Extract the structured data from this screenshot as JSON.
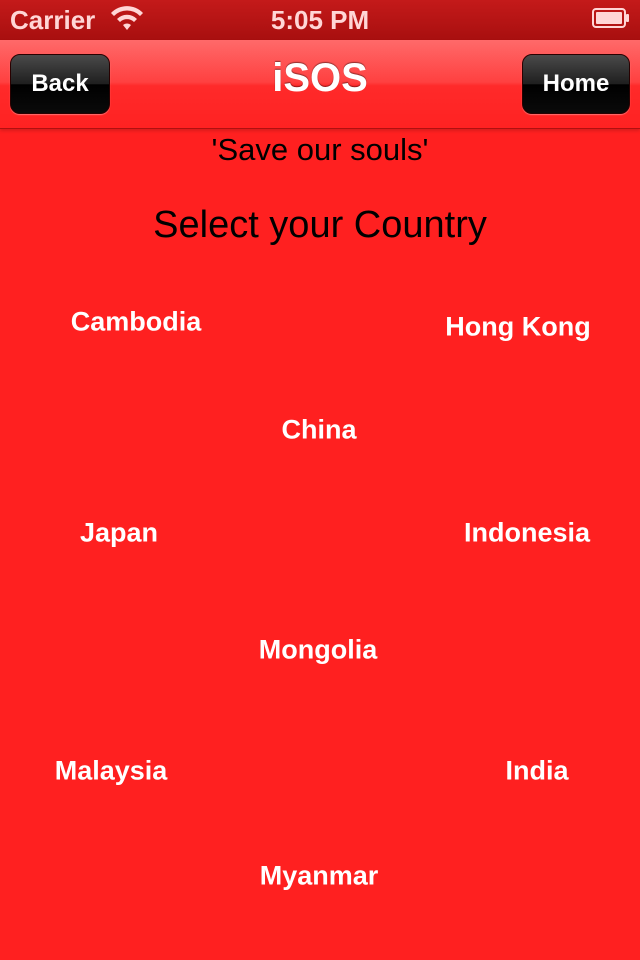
{
  "status_bar": {
    "carrier": "Carrier",
    "time": "5:05 PM"
  },
  "nav": {
    "title": "iSOS",
    "back_label": "Back",
    "home_label": "Home"
  },
  "subtitle": "'Save our souls'",
  "heading": "Select your Country",
  "countries": [
    "Cambodia",
    "Hong Kong",
    "China",
    "Japan",
    "Indonesia",
    "Mongolia",
    "Malaysia",
    "India",
    "Myanmar"
  ],
  "colors": {
    "background": "#ff2020",
    "button": "#000000",
    "text_light": "#ffffff"
  }
}
